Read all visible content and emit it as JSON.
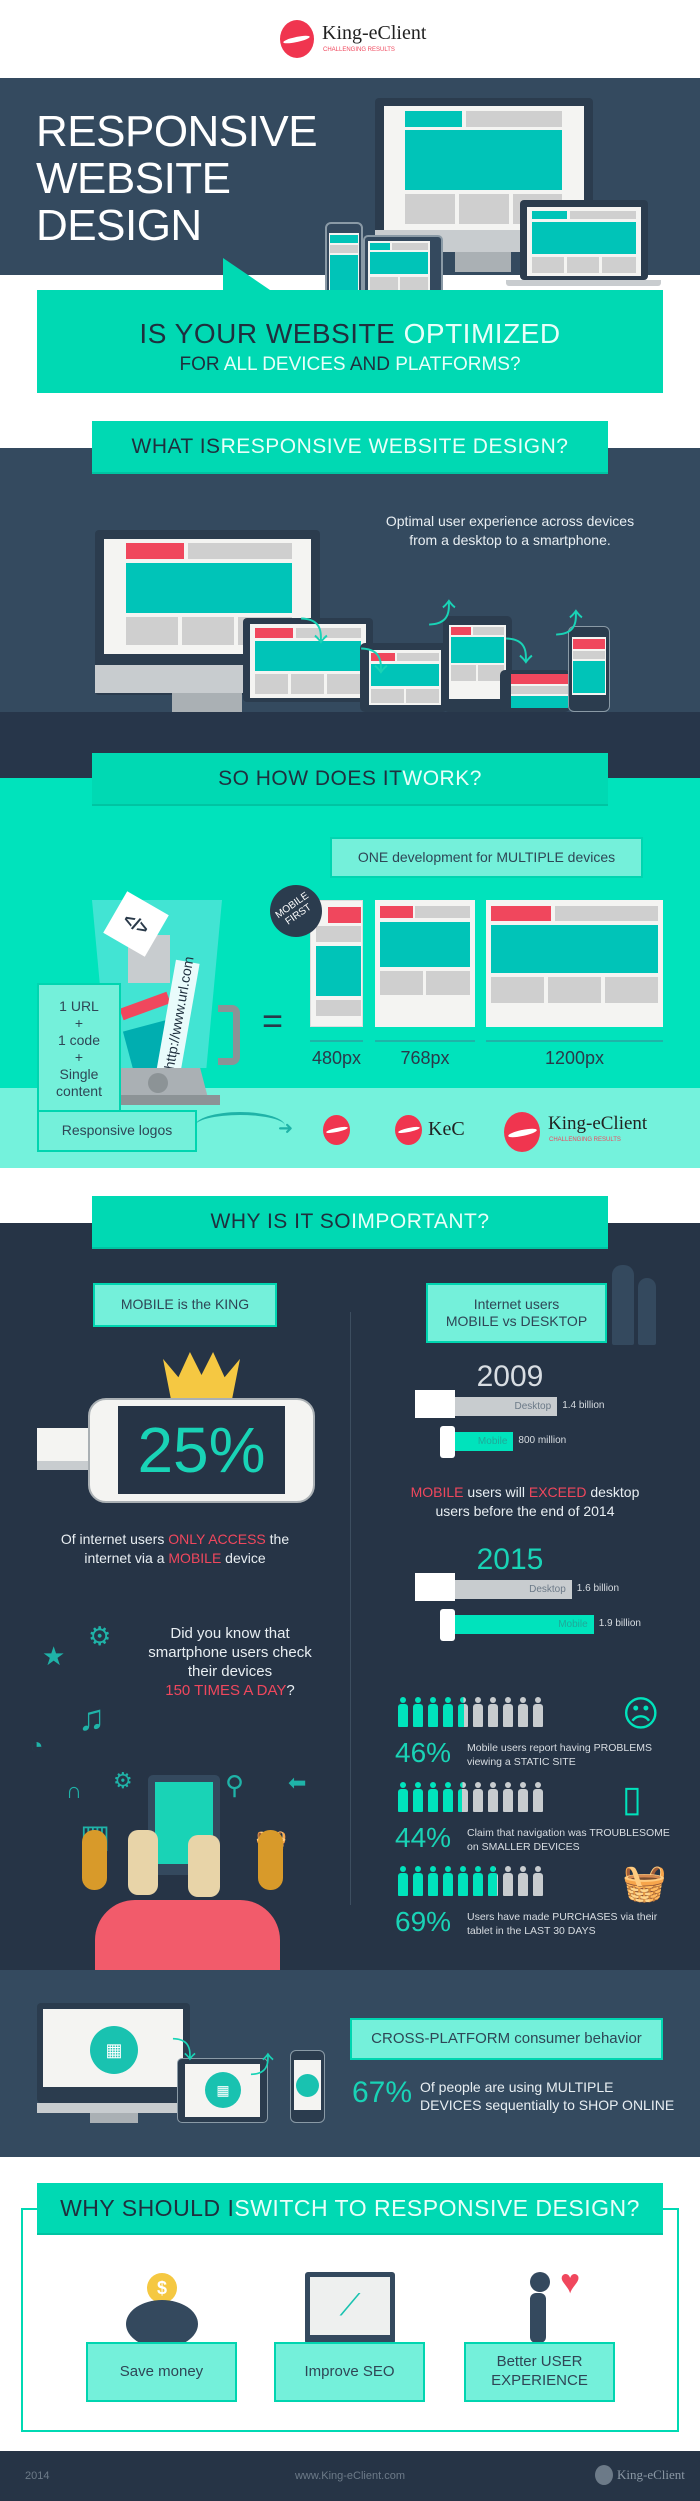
{
  "brand": {
    "name": "King-eClient",
    "tagline": "CHALLENGING RESULTS",
    "short": "KeC",
    "colors": {
      "teal": "#00d9b3",
      "light_teal": "#74f0da",
      "dark": "#344a5f",
      "darker": "#263446",
      "red": "#f0475d"
    }
  },
  "hero": {
    "title_lines": [
      "RESPONSIVE",
      "WEBSITE",
      "DESIGN"
    ],
    "question": {
      "p1": "IS YOUR WEBSITE ",
      "p2": "OPTIMIZED",
      "p3": "FOR ",
      "p4": "ALL DEVICES ",
      "p5": "AND ",
      "p6": "PLATFORMS?"
    }
  },
  "what": {
    "heading_a": "WHAT IS ",
    "heading_b": "RESPONSIVE WEBSITE DESIGN?",
    "description": [
      "Optimal user experience across devices",
      "from a desktop to a smartphone."
    ]
  },
  "how": {
    "heading_a": "SO HOW DOES IT ",
    "heading_b": "WORK?",
    "one_dev": "ONE development for MULTIPLE devices",
    "ingredients": [
      "1 URL",
      "+",
      "1 code",
      "+",
      "Single",
      "content"
    ],
    "url": "http://www.url.com",
    "code": "</>",
    "equals": "=",
    "mobile_first": [
      "MOBILE",
      "FIRST"
    ],
    "breakpoints": [
      "480px",
      "768px",
      "1200px"
    ],
    "responsive_logos": "Responsive logos"
  },
  "important": {
    "heading_a": "WHY IS IT SO ",
    "heading_b": "IMPORTANT?",
    "mobile_king": "MOBILE is the KING",
    "mobile_percent": "25%",
    "mobile_text": {
      "p1": "Of internet users ",
      "p2": "ONLY ACCESS",
      "p3": " the",
      "p4": "internet via a ",
      "p5": "MOBILE",
      "p6": " device"
    },
    "users_box": [
      "Internet users",
      "MOBILE vs DESKTOP"
    ],
    "years": [
      {
        "year": "2009",
        "desktop_label": "Desktop",
        "desktop_value": "1.4 billion",
        "desktop_billions": 1.4,
        "mobile_label": "Mobile",
        "mobile_value": "800 million",
        "mobile_billions": 0.8
      },
      {
        "year": "2015",
        "desktop_label": "Desktop",
        "desktop_value": "1.6 billion",
        "desktop_billions": 1.6,
        "mobile_label": "Mobile",
        "mobile_value": "1.9 billion",
        "mobile_billions": 1.9
      }
    ],
    "exceed": {
      "p1": "MOBILE",
      "p2": " users will ",
      "p3": "EXCEED",
      "p4": " desktop",
      "p5": "users before the end of 2014"
    },
    "did_you_know": {
      "lines": [
        "Did you know that",
        "smartphone users check",
        "their devices"
      ],
      "highlight": "150 TIMES A DAY",
      "end": "?"
    },
    "stats": [
      {
        "percent": "46%",
        "value": 46,
        "lines": [
          "Mobile users report having PROBLEMS",
          "viewing a STATIC SITE"
        ],
        "icon": "sad-face-icon"
      },
      {
        "percent": "44%",
        "value": 44,
        "lines": [
          "Claim that navigation was TROUBLESOME",
          "on SMALLER DEVICES"
        ],
        "icon": "phone-rotate-icon"
      },
      {
        "percent": "69%",
        "value": 69,
        "lines": [
          "Users have made PURCHASES via their",
          "tablet in the LAST 30 DAYS"
        ],
        "icon": "basket-icon"
      }
    ]
  },
  "cross": {
    "box": "CROSS-PLATFORM consumer behavior",
    "percent": "67%",
    "lines": [
      "Of people are using MULTIPLE",
      "DEVICES sequentially to SHOP ONLINE"
    ]
  },
  "switch": {
    "heading_a": "WHY SHOULD I ",
    "heading_b": "SWITCH TO RESPONSIVE DESIGN?",
    "cards": [
      {
        "label": [
          "Save money"
        ],
        "icon": "piggy-bank-icon"
      },
      {
        "label": [
          "Improve SEO"
        ],
        "icon": "chart-monitor-icon"
      },
      {
        "label": [
          "Better USER",
          "EXPERIENCE"
        ],
        "icon": "happy-person-heart-icon"
      }
    ]
  },
  "footer": {
    "year": "2014",
    "url": "www.King-eClient.com",
    "brand": "King-eClient"
  }
}
